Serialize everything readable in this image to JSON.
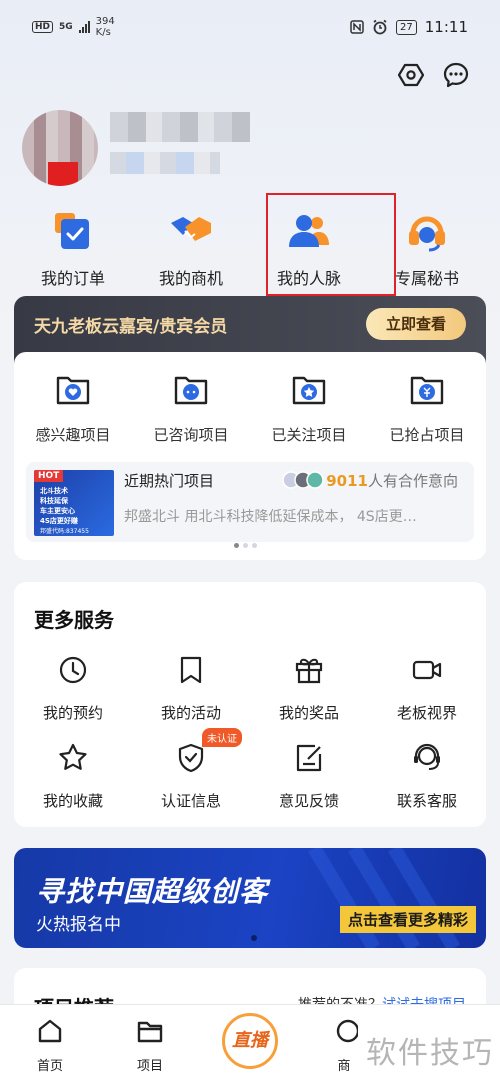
{
  "status_bar": {
    "hd": "HD",
    "network": "5G",
    "speed_value": "394",
    "speed_unit": "K/s",
    "battery": "27",
    "time": "11:11"
  },
  "header": {
    "settings_icon": "settings-hexagon-icon",
    "message_icon": "message-bubble-icon"
  },
  "quick_actions": [
    {
      "label": "我的订单",
      "icon": "order-icon"
    },
    {
      "label": "我的商机",
      "icon": "handshake-icon"
    },
    {
      "label": "我的人脉",
      "icon": "contacts-icon"
    },
    {
      "label": "专属秘书",
      "icon": "headset-icon"
    }
  ],
  "vip": {
    "title": "天九老板云嘉宾/贵宾会员",
    "button": "立即查看"
  },
  "projects": [
    {
      "label": "感兴趣项目",
      "icon": "heart-folder-icon"
    },
    {
      "label": "已咨询项目",
      "icon": "chat-folder-icon"
    },
    {
      "label": "已关注项目",
      "icon": "star-folder-icon"
    },
    {
      "label": "已抢占项目",
      "icon": "yuan-folder-icon"
    }
  ],
  "hot": {
    "tag": "HOT",
    "title": "近期热门项目",
    "count": "9011",
    "count_suffix": "人有合作意向",
    "desc": "邦盛北斗 用北斗科技降低延保成本， 4S店更…",
    "thumb_lines": [
      "北斗技术",
      "科技延保",
      "车主更安心",
      "4S店更好赚",
      "邦盛代码:837455"
    ]
  },
  "more_services": {
    "title": "更多服务",
    "items": [
      {
        "label": "我的预约",
        "icon": "clock-icon"
      },
      {
        "label": "我的活动",
        "icon": "bookmark-icon"
      },
      {
        "label": "我的奖品",
        "icon": "gift-icon"
      },
      {
        "label": "老板视界",
        "icon": "video-camera-icon"
      },
      {
        "label": "我的收藏",
        "icon": "star-icon"
      },
      {
        "label": "认证信息",
        "icon": "shield-check-icon",
        "badge": "未认证"
      },
      {
        "label": "意见反馈",
        "icon": "feedback-edit-icon"
      },
      {
        "label": "联系客服",
        "icon": "customer-service-icon"
      }
    ]
  },
  "banner": {
    "title": "寻找中国超级创客",
    "subtitle": "火热报名中",
    "cta": "点击查看更多精彩"
  },
  "recommend": {
    "title": "项目推荐",
    "hint": "推荐的不准？",
    "link": "试试去搜项目"
  },
  "bottom_nav": [
    {
      "label": "首页",
      "icon": "home-icon"
    },
    {
      "label": "项目",
      "icon": "folder-icon"
    },
    {
      "label": "直播",
      "icon": "live-icon"
    },
    {
      "label": "商",
      "icon": "business-icon"
    }
  ],
  "watermark": "软件技巧",
  "colors": {
    "accent_blue": "#2f6be0",
    "orange": "#f7932a",
    "highlight_red": "#e0232b",
    "gold": "#f4d9a6"
  }
}
